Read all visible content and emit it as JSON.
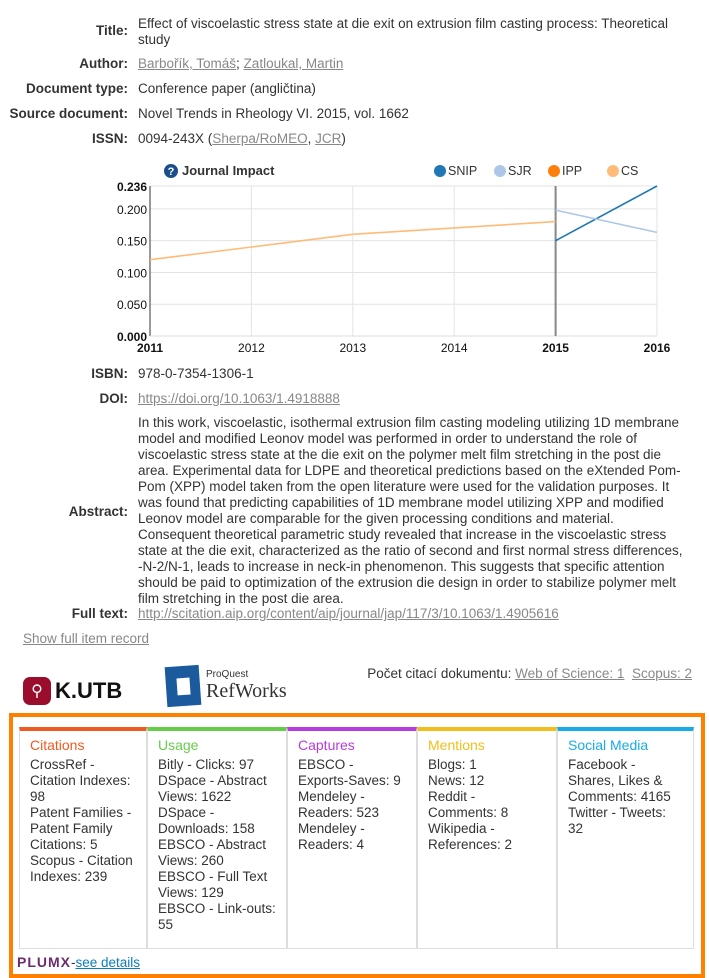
{
  "record": {
    "title_label": "Title:",
    "title": "Effect of viscoelastic stress state at die exit on extrusion film casting process: Theoretical study",
    "author_label": "Author:",
    "authors": [
      "Barbořík, Tomáš",
      "Zatloukal, Martin"
    ],
    "doctype_label": "Document type:",
    "doctype": "Conference paper (angličtina)",
    "source_label": "Source document:",
    "source": "Novel Trends in Rheology VI. 2015, vol. 1662",
    "issn_label": "ISSN:",
    "issn": "0094-243X (",
    "issn_link1": "Sherpa/RoMEO",
    "issn_link2": "JCR",
    "issn_end": ")",
    "isbn_label": "ISBN:",
    "isbn": "978-0-7354-1306-1",
    "doi_label": "DOI:",
    "doi": "https://doi.org/10.1063/1.4918888",
    "abstract_label": "Abstract:",
    "abstract": "In this work, viscoelastic, isothermal extrusion film casting modeling utilizing 1D membrane model and modified Leonov model was performed in order to understand the role of viscoelastic stress state at the die exit on the polymer melt film stretching in the post die area. Experimental data for LDPE and theoretical predictions based on the eXtended Pom-Pom (XPP) model taken from the open literature were used for the validation purposes. It was found that predicting capabilities of 1D membrane model utilizing XPP and modified Leonov model are comparable for the given processing conditions and material. Consequent theoretical parametric study revealed that increase in the viscoelastic stress state at the die exit, characterized as the ratio of second and first normal stress differences, -N-2/N-1, leads to increase in neck-in phenomenon. This suggests that specific attention should be paid to optimization of the extrusion die design in order to stabilize polymer melt film stretching in the post die area.",
    "fulltext_label": "Full text:",
    "fulltext": "http://scitation.aip.org/content/aip/journal/jap/117/3/10.1063/1.4905616",
    "show_full": "Show full item record"
  },
  "chart_data": {
    "type": "line",
    "title": "Journal Impact",
    "help_icon": "question-circle-icon",
    "x": [
      2011,
      2012,
      2013,
      2014,
      2015,
      2016
    ],
    "xlim": [
      2011,
      2016
    ],
    "ylim": [
      0,
      0.236
    ],
    "yticks": [
      "0.000",
      "0.050",
      "0.100",
      "0.150",
      "0.200",
      "0.236"
    ],
    "grid": true,
    "legend": "top-right",
    "marker_year": 2015,
    "series": [
      {
        "name": "SNIP",
        "color": "#1f77b4",
        "points": [
          [
            2015,
            0.15
          ],
          [
            2016,
            0.236
          ]
        ]
      },
      {
        "name": "SJR",
        "color": "#aec7e8",
        "points": [
          [
            2015,
            0.198
          ],
          [
            2016,
            0.163
          ]
        ]
      },
      {
        "name": "IPP",
        "color": "#ff7f0e",
        "points": []
      },
      {
        "name": "CS",
        "color": "#ffbb78",
        "points": [
          [
            2011,
            0.12
          ],
          [
            2012,
            0.14
          ],
          [
            2013,
            0.16
          ],
          [
            2014,
            0.17
          ],
          [
            2015,
            0.18
          ]
        ]
      }
    ]
  },
  "logos": {
    "kutb": "K.UTB",
    "refworks_small": "ProQuest",
    "refworks": "RefWorks"
  },
  "citations": {
    "label": "Počet citací dokumentu:",
    "wos": "Web of Science: 1",
    "scopus": "Scopus: 2"
  },
  "plumx": {
    "columns": [
      {
        "title": "Citations",
        "color": "#f05a22",
        "items": [
          "CrossRef - Citation Indexes: 98",
          "Patent Families - Patent Family Citations: 5",
          "Scopus - Citation Indexes: 239"
        ]
      },
      {
        "title": "Usage",
        "color": "#66cc4a",
        "items": [
          "Bitly - Clicks: 97",
          "DSpace - Abstract Views: 1622",
          "DSpace - Downloads: 158",
          "EBSCO - Abstract Views: 260",
          "EBSCO - Full Text Views: 129",
          "EBSCO - Link-outs: 55"
        ]
      },
      {
        "title": "Captures",
        "color": "#b83be0",
        "items": [
          "EBSCO - Exports-Saves: 9",
          "Mendeley - Readers: 523",
          "Mendeley - Readers: 4"
        ]
      },
      {
        "title": "Mentions",
        "color": "#f2be1b",
        "items": [
          "Blogs: 1",
          "News: 12",
          "Reddit - Comments: 8",
          "Wikipedia - References: 2"
        ]
      },
      {
        "title": "Social Media",
        "color": "#17ace6",
        "items": [
          "Facebook - Shares, Likes & Comments: 4165",
          "Twitter - Tweets: 32"
        ]
      }
    ],
    "logo": "PLUMX",
    "sep": " - ",
    "see_details": "see details"
  }
}
